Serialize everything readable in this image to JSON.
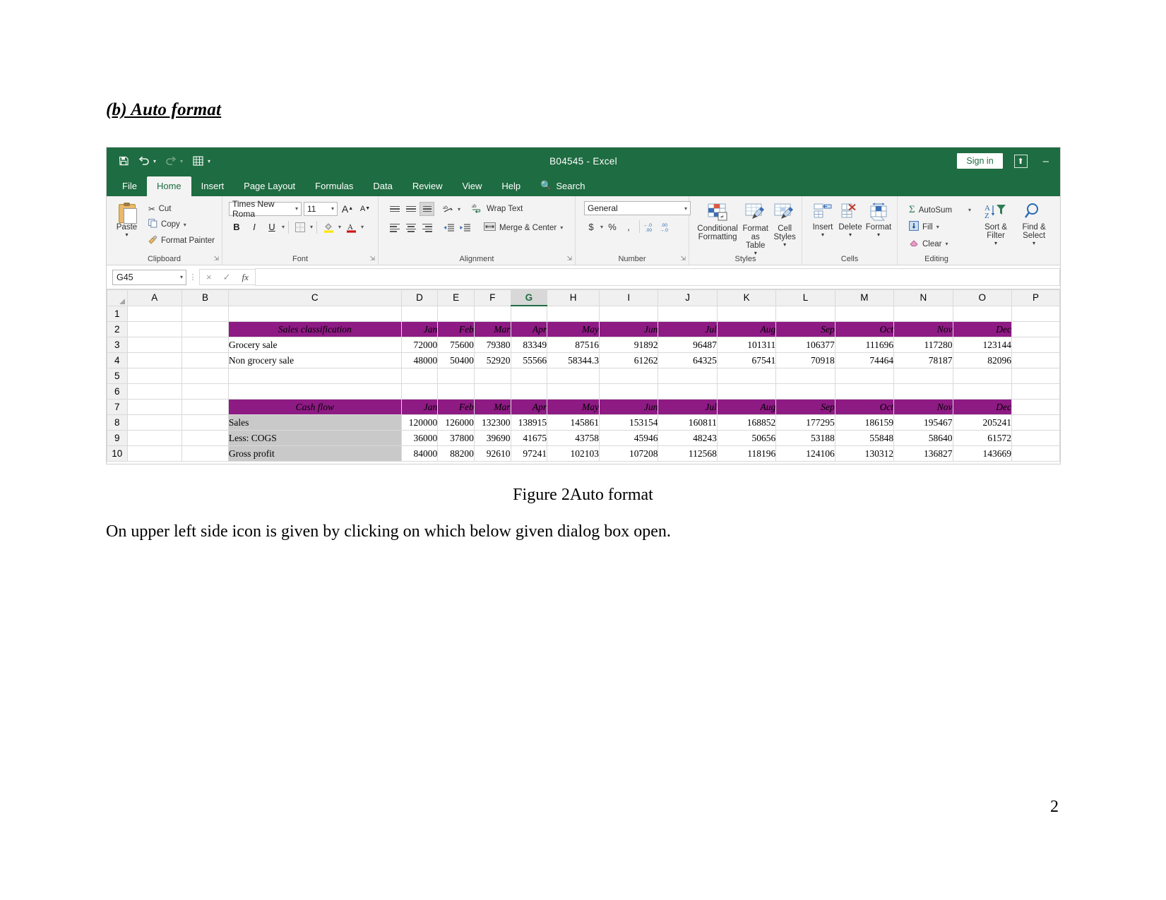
{
  "document": {
    "heading": "(b) Auto format",
    "figure_caption": "Figure 2Auto format",
    "paragraph": "On upper left side icon is given by clicking on which below given dialog box open.",
    "page_number": "2"
  },
  "excel": {
    "title": "B04545  -  Excel",
    "sign_in": "Sign in",
    "minimize": "–",
    "quick_access": [
      "save-icon",
      "undo-icon",
      "redo-icon",
      "quick-print-icon",
      "customize-icon"
    ],
    "tabs": [
      {
        "label": "File",
        "active": false
      },
      {
        "label": "Home",
        "active": true
      },
      {
        "label": "Insert",
        "active": false
      },
      {
        "label": "Page Layout",
        "active": false
      },
      {
        "label": "Formulas",
        "active": false
      },
      {
        "label": "Data",
        "active": false
      },
      {
        "label": "Review",
        "active": false
      },
      {
        "label": "View",
        "active": false
      },
      {
        "label": "Help",
        "active": false
      }
    ],
    "search_label": "Search",
    "ribbon": {
      "clipboard": {
        "group_label": "Clipboard",
        "paste": "Paste",
        "cut": "Cut",
        "copy": "Copy",
        "format_painter": "Format Painter"
      },
      "font": {
        "group_label": "Font",
        "font_name": "Times New Roma",
        "font_size": "11",
        "bold": "B",
        "italic": "I",
        "underline": "U",
        "grow_font": "A",
        "shrink_font": "A"
      },
      "alignment": {
        "group_label": "Alignment",
        "wrap_text": "Wrap Text",
        "merge_center": "Merge & Center"
      },
      "number": {
        "group_label": "Number",
        "format": "General",
        "currency": "$",
        "percent": "%",
        "comma": ","
      },
      "styles": {
        "group_label": "Styles",
        "conditional_formatting": "Conditional\nFormatting",
        "conditional_formatting_l1": "Conditional",
        "conditional_formatting_l2": "Formatting",
        "format_as_table_l1": "Format as",
        "format_as_table_l2": "Table",
        "cell_styles_l1": "Cell",
        "cell_styles_l2": "Styles"
      },
      "cells": {
        "group_label": "Cells",
        "insert": "Insert",
        "delete": "Delete",
        "format": "Format"
      },
      "editing": {
        "group_label": "Editing",
        "autosum": "AutoSum",
        "fill": "Fill",
        "clear": "Clear",
        "sort_filter_l1": "Sort &",
        "sort_filter_l2": "Filter",
        "find_select_l1": "Find &",
        "find_select_l2": "Select"
      }
    },
    "formula_bar": {
      "name_box": "G45",
      "cancel": "×",
      "enter": "✓",
      "insert_function": "fx",
      "formula_value": ""
    },
    "sheet": {
      "column_headers": [
        "A",
        "B",
        "C",
        "D",
        "E",
        "F",
        "G",
        "H",
        "I",
        "J",
        "K",
        "L",
        "M",
        "N",
        "O",
        "P"
      ],
      "selected_column": "G",
      "row_headers": [
        "1",
        "2",
        "3",
        "4",
        "5",
        "6",
        "7",
        "8",
        "9",
        "10"
      ],
      "table1": {
        "title": "Sales classification",
        "months": [
          "Jan",
          "Feb",
          "Mar",
          "Apr",
          "May",
          "Jun",
          "Jul",
          "Aug",
          "Sep",
          "Oct",
          "Nov",
          "Dec"
        ],
        "rows": [
          {
            "label": "Grocery sale",
            "values": [
              "72000",
              "75600",
              "79380",
              "83349",
              "87516",
              "91892",
              "96487",
              "101311",
              "106377",
              "111696",
              "117280",
              "123144"
            ]
          },
          {
            "label": "Non grocery sale",
            "values": [
              "48000",
              "50400",
              "52920",
              "55566",
              "58344.3",
              "61262",
              "64325",
              "67541",
              "70918",
              "74464",
              "78187",
              "82096"
            ]
          }
        ]
      },
      "table2": {
        "title": "Cash flow",
        "months": [
          "Jan",
          "Feb",
          "Mar",
          "Apr",
          "May",
          "Jun",
          "Jul",
          "Aug",
          "Sep",
          "Oct",
          "Nov",
          "Dec"
        ],
        "rows": [
          {
            "label": "Sales",
            "style": "black-bold",
            "values": [
              "120000",
              "126000",
              "132300",
              "138915",
              "145861",
              "153154",
              "160811",
              "168852",
              "177295",
              "186159",
              "195467",
              "205241"
            ]
          },
          {
            "label": "Less: COGS",
            "style": "blue-bold",
            "values": [
              "36000",
              "37800",
              "39690",
              "41675",
              "43758",
              "45946",
              "48243",
              "50656",
              "53188",
              "55848",
              "58640",
              "61572"
            ]
          },
          {
            "label": "Gross profit",
            "style": "blue-bold",
            "values": [
              "84000",
              "88200",
              "92610",
              "97241",
              "102103",
              "107208",
              "112568",
              "118196",
              "124106",
              "130312",
              "136827",
              "143669"
            ]
          }
        ]
      }
    },
    "colors": {
      "chrome_green": "#1e6c41",
      "header_purple": "#8e1a84",
      "gray_fill": "#c9c9c9",
      "blue_text": "#2a27a8"
    }
  }
}
